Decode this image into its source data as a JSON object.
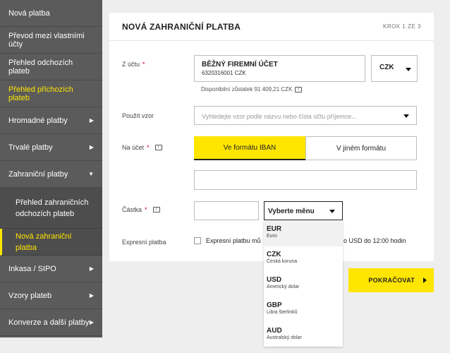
{
  "sidebar": {
    "items": [
      {
        "label": "Nová platba"
      },
      {
        "label": "Převod mezi vlastními účty"
      },
      {
        "label": "Přehled odchozích plateb"
      },
      {
        "label": "Přehled příchozích plateb"
      },
      {
        "label": "Hromadné platby"
      },
      {
        "label": "Trvalé platby"
      },
      {
        "label": "Zahraniční platby"
      },
      {
        "label": "Přehled zahraničních odchozích plateb"
      },
      {
        "label": "Nová zahraniční platba"
      },
      {
        "label": "Inkasa / SIPO"
      },
      {
        "label": "Vzory plateb"
      },
      {
        "label": "Konverze a další platby"
      }
    ]
  },
  "card": {
    "title": "NOVÁ ZAHRANIČNÍ PLATBA",
    "step": "KROK 1 ZE 3"
  },
  "form": {
    "from_label": "Z účtu",
    "account_name": "BĚŽNÝ FIREMNÍ ÚČET",
    "account_number": "6320316001 CZK",
    "account_currency": "CZK",
    "balance": "Disponibilní zůstatek 91 409,21 CZK",
    "template_label": "Použít vzor",
    "template_placeholder": "Vyhledejte vzor podle názvu nebo čísla účtu příjemce...",
    "to_label": "Na účet",
    "tab_iban": "Ve formátu IBAN",
    "tab_other": "V jiném formátu",
    "amount_label": "Částka",
    "currency_select": "Vyberte měnu",
    "express_label": "Expresní platba",
    "express_text_left": "Expresní platbu mů",
    "express_text_right": "o USD do 12:00 hodin",
    "required_mark": "*"
  },
  "currencies": [
    {
      "code": "EUR",
      "name": "Euro"
    },
    {
      "code": "CZK",
      "name": "Česká koruna"
    },
    {
      "code": "USD",
      "name": "Americký dolar"
    },
    {
      "code": "GBP",
      "name": "Libra šterlinků"
    },
    {
      "code": "AUD",
      "name": "Australský dolar"
    }
  ],
  "actions": {
    "continue_label": "POKRAČOVAT"
  },
  "colors": {
    "accent": "#ffe600",
    "sidebar": "#5b5b5b",
    "required": "#d0021b"
  },
  "icons": {
    "balance_info": "info-icon",
    "to_info": "info-icon",
    "amount_info": "info-icon"
  }
}
